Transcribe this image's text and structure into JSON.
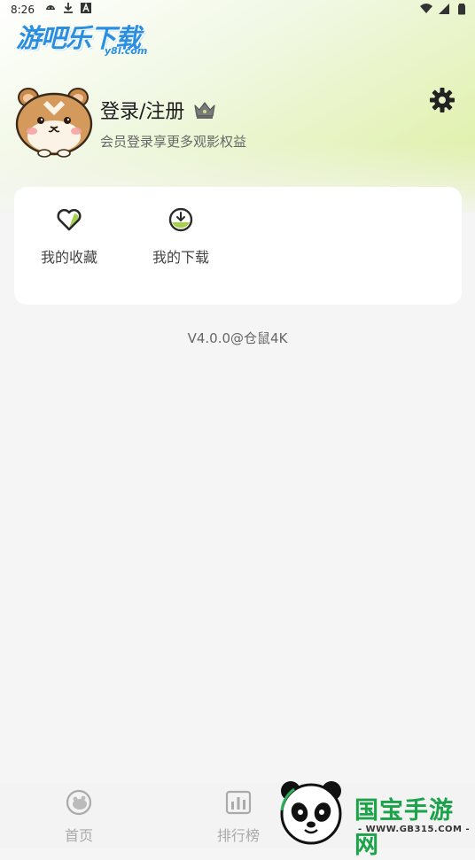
{
  "status_bar": {
    "time": "8:26",
    "left_icons": [
      "android-icon",
      "download-icon",
      "a-badge-icon"
    ],
    "right_icons": [
      "wifi-icon",
      "signal-icon",
      "battery-icon"
    ]
  },
  "watermark_top": {
    "text": "游吧乐下载",
    "sub": "y8l.com"
  },
  "profile": {
    "username": "登录/注册",
    "subtitle": "会员登录享更多观影权益",
    "crown_icon": "crown-icon",
    "settings_icon": "gear-icon"
  },
  "quick_actions": [
    {
      "label": "我的收藏",
      "icon": "heart-icon"
    },
    {
      "label": "我的下载",
      "icon": "download-circle-icon"
    }
  ],
  "version": "V4.0.0@仓鼠4K",
  "bottom_nav": [
    {
      "label": "首页",
      "icon": "home-icon"
    },
    {
      "label": "排行榜",
      "icon": "chart-icon"
    }
  ],
  "watermark_bottom": {
    "title": "国宝手游网",
    "url": "- WWW.GB315.COM -"
  },
  "colors": {
    "accent_green": "#8dc63f",
    "background": "#f5f5f5"
  }
}
